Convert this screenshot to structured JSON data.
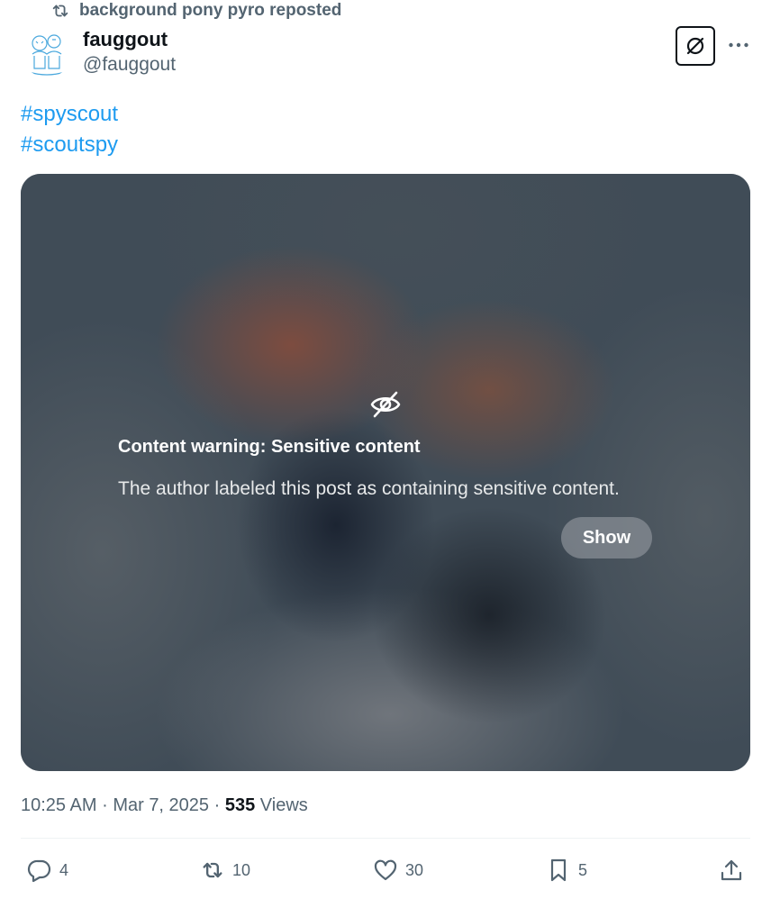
{
  "repost": {
    "text": "background pony pyro reposted"
  },
  "author": {
    "name": "fauggout",
    "handle": "@fauggout"
  },
  "tweet": {
    "hashtags": [
      "#spyscout",
      "#scoutspy"
    ]
  },
  "media": {
    "warning_title": "Content warning: Sensitive content",
    "warning_description": "The author labeled this post as containing sensitive content.",
    "show_label": "Show"
  },
  "meta": {
    "time": "10:25 AM",
    "separator": "·",
    "date": "Mar 7, 2025",
    "views_count": "535",
    "views_label": "Views"
  },
  "actions": {
    "replies": "4",
    "reposts": "10",
    "likes": "30",
    "bookmarks": "5"
  },
  "icons": {
    "repost": "repost-icon",
    "grok": "grok-icon",
    "more": "more-icon",
    "hidden": "eye-off-icon",
    "reply": "reply-icon",
    "like": "heart-icon",
    "bookmark": "bookmark-icon",
    "share": "share-icon"
  },
  "colors": {
    "link": "#1d9bf0",
    "secondary_text": "#536471",
    "primary_text": "#0f1419"
  }
}
